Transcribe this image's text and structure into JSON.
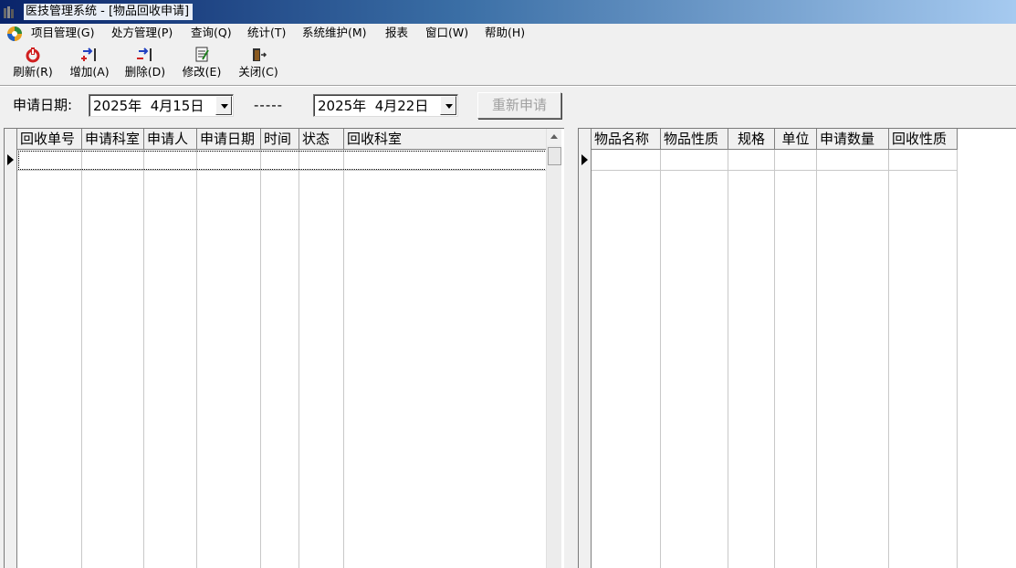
{
  "window": {
    "title": "医技管理系统 - [物品回收申请]"
  },
  "menu": {
    "items": [
      "项目管理(G)",
      "处方管理(P)",
      "查询(Q)",
      "统计(T)",
      "系统维护(M)",
      "报表",
      "窗口(W)",
      "帮助(H)"
    ]
  },
  "toolbar": {
    "refresh": "刷新(R)",
    "add": "增加(A)",
    "delete": "删除(D)",
    "edit": "修改(E)",
    "close": "关闭(C)"
  },
  "filter": {
    "label": "申请日期:",
    "start_date": "2025年  4月15日",
    "separator": "-----",
    "end_date": "2025年  4月22日",
    "reapply_button": "重新申请"
  },
  "left_grid": {
    "columns": [
      "回收单号",
      "申请科室",
      "申请人",
      "申请日期",
      "时间",
      "状态",
      "回收科室"
    ]
  },
  "right_grid": {
    "columns": [
      "物品名称",
      "物品性质",
      "规格",
      "单位",
      "申请数量",
      "回收性质"
    ]
  },
  "colors": {
    "title_gradient_start": "#0a246a",
    "title_gradient_end": "#a6caf0",
    "window_bg": "#f0f0f0",
    "disabled_text": "#a0a0a0"
  }
}
